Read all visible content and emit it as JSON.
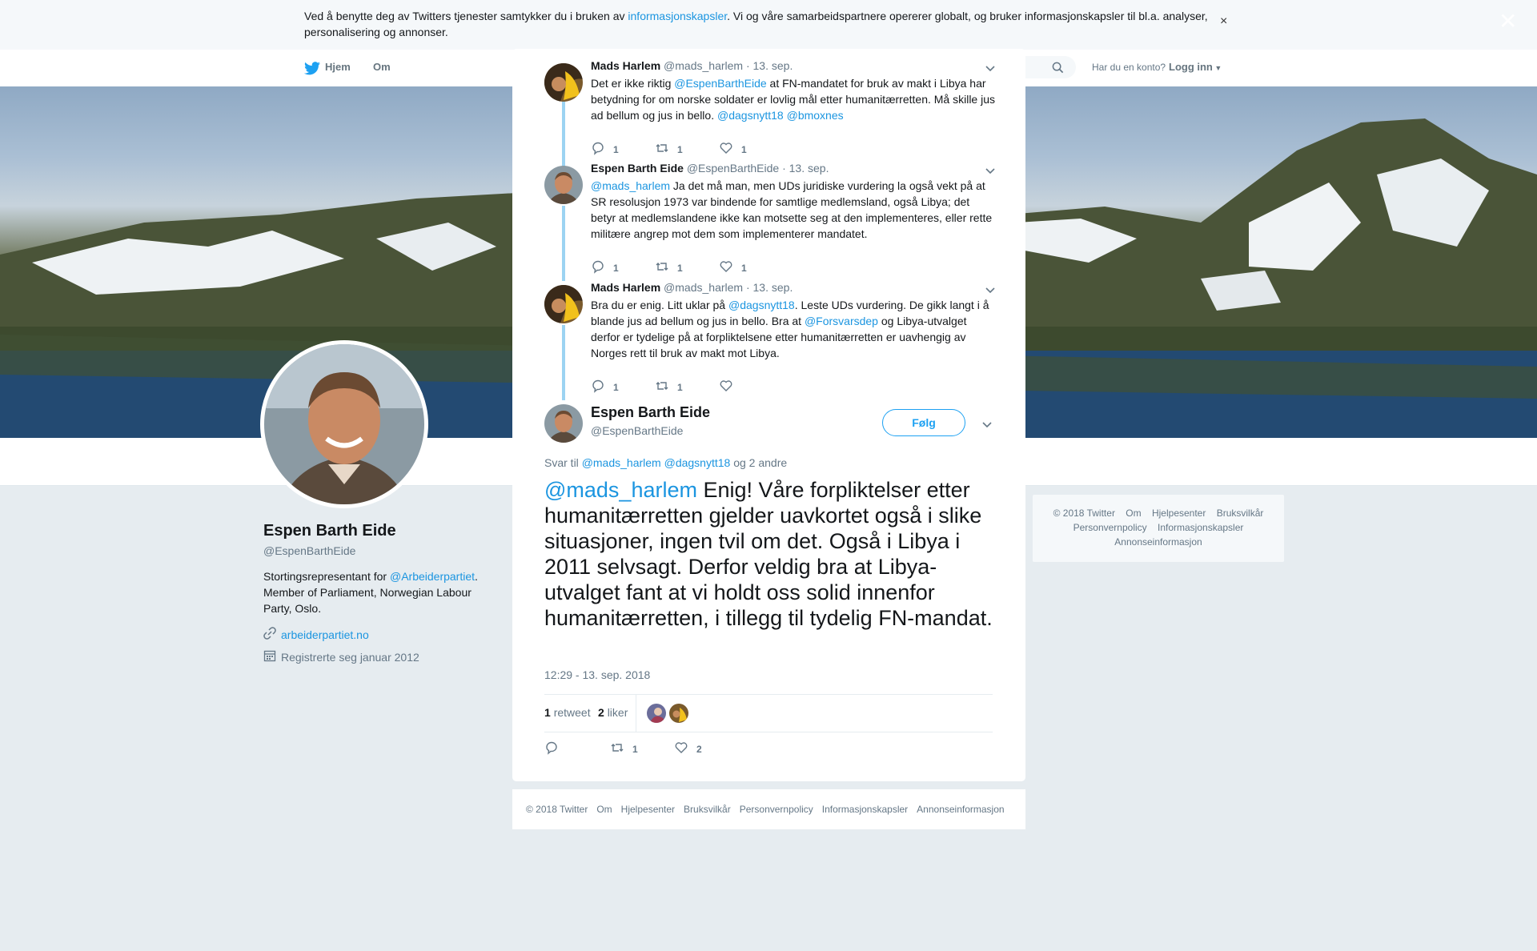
{
  "cookie": {
    "text_before": "Ved å benytte deg av Twitters tjenester samtykker du i bruken av ",
    "link": "informasjonskapsler",
    "text_after": ". Vi og våre samarbeidspartnere opererer globalt, og bruker informasjonskapsler til bl.a. analyser, personalisering og annonser.",
    "close": "×"
  },
  "nav": {
    "home": "Hjem",
    "about": "Om",
    "have_account": "Har du en konto?",
    "login": "Logg inn"
  },
  "profile": {
    "name": "Espen Barth Eide",
    "handle": "@EspenBarthEide",
    "bio_before": "Stortingsrepresentant for ",
    "bio_link": "@Arbeiderpartiet",
    "bio_after": ". Member of Parliament, Norwegian Labour Party, Oslo.",
    "website": "arbeiderpartiet.no",
    "joined": "Registrerte seg januar 2012"
  },
  "right_footer": {
    "line1": [
      "© 2018 Twitter",
      "Om",
      "Hjelpesenter",
      "Bruksvilkår"
    ],
    "line2": [
      "Personvernpolicy",
      "Informasjonskapsler"
    ],
    "line3": [
      "Annonseinformasjon"
    ]
  },
  "overlay": {
    "close": "✕"
  },
  "thread": [
    {
      "name": "Mads Harlem",
      "handle": "@mads_harlem",
      "date": "· 13. sep.",
      "t1": "Det er ikke riktig ",
      "l1": "@EspenBarthEide",
      "t2": " at FN-mandatet for bruk av makt i Libya har betydning for om norske soldater er lovlig mål etter humanitærretten. Må skille jus ad bellum og jus in bello. ",
      "l2": "@dagsnytt18",
      "l3": " @bmoxnes",
      "replies": "1",
      "retweets": "1",
      "likes": "1"
    },
    {
      "name": "Espen Barth Eide",
      "handle": "@EspenBarthEide",
      "date": "· 13. sep.",
      "l1": "@mads_harlem",
      "t1": " Ja det må man, men UDs juridiske vurdering la også vekt på at SR resolusjon 1973 var bindende for samtlige medlemsland, også Libya; det betyr at medlemslandene ikke kan motsette seg at den implementeres, eller rette militære angrep mot dem som implementerer mandatet.",
      "replies": "1",
      "retweets": "1",
      "likes": "1"
    },
    {
      "name": "Mads Harlem",
      "handle": "@mads_harlem",
      "date": "· 13. sep.",
      "t1": "Bra du er enig. Litt uklar på ",
      "l1": "@dagsnytt18",
      "t2": ". Leste UDs vurdering. De gikk langt i å blande jus ad bellum og jus in bello. Bra at ",
      "l2": "@Forsvarsdep",
      "t3": " og Libya-utvalget derfor er tydelige  på at forpliktelsene etter humanitærretten er uavhengig av Norges rett til bruk av makt mot Libya.",
      "replies": "1",
      "retweets": "1",
      "likes": ""
    }
  ],
  "main_tweet": {
    "name": "Espen Barth Eide",
    "handle": "@EspenBarthEide",
    "follow": "Følg",
    "reply_prefix": "Svar til ",
    "reply_user1": "@mads_harlem",
    "reply_user2": "@dagsnytt18",
    "reply_suffix": " og 2 andre",
    "mention": "@mads_harlem",
    "text": " Enig! Våre forpliktelser etter humanitærretten gjelder uavkortet også i slike situasjoner, ingen tvil om det. Også i Libya i 2011 selvsagt. Derfor veldig bra at Libya-utvalget fant at vi holdt oss solid innenfor humanitærretten, i tillegg til tydelig FN-mandat.",
    "timestamp": "12:29 - 13. sep. 2018",
    "retweet_count": "1",
    "retweet_label": "retweet",
    "like_count": "2",
    "like_label": "liker",
    "action_retweets": "1",
    "action_likes": "2"
  },
  "modal_footer": [
    "© 2018 Twitter",
    "Om",
    "Hjelpesenter",
    "Bruksvilkår",
    "Personvernpolicy",
    "Informasjonskapsler",
    "Annonseinformasjon"
  ]
}
